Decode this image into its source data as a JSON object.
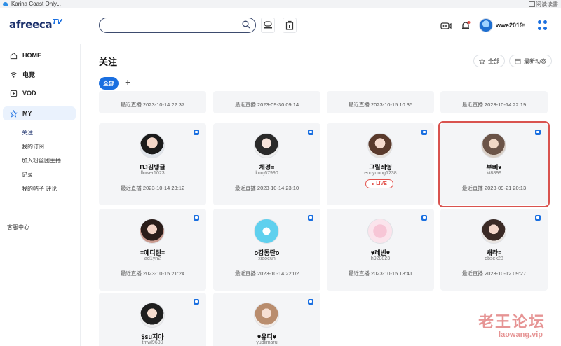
{
  "os_bar": {
    "app_title": "Karina Coast Only...",
    "read_mode": "阅读读書"
  },
  "header": {
    "logo": "afreeca",
    "logo_suffix": "TV",
    "search_placeholder": "",
    "username": "wwe2019",
    "icons": {
      "search": "search-icon",
      "afreecatv": "afreecatv-app-icon",
      "store": "store-icon",
      "broadcast": "broadcast-camera-icon",
      "notifications": "bell-icon",
      "apps": "apps-grid-icon"
    },
    "accent_color": "#1a6fe0"
  },
  "sidebar": {
    "nav": [
      {
        "label": "HOME",
        "icon": "home-icon",
        "active": false
      },
      {
        "label": "电竞",
        "icon": "esports-icon",
        "active": false
      },
      {
        "label": "VOD",
        "icon": "vod-icon",
        "active": false
      },
      {
        "label": "MY",
        "icon": "star-icon",
        "active": true
      }
    ],
    "sub": [
      "关注",
      "我的订阅",
      "加入粉丝团主播",
      "记录",
      "我的帖子 评论"
    ],
    "service_center": "客服中心"
  },
  "main": {
    "title": "关注",
    "sort_all": "全部",
    "sort_recent": "最新动态",
    "filter_all": "全部",
    "add_filter": "+"
  },
  "cards": {
    "top_row": [
      {
        "last_live": "最近直播 2023-10-14 22:37"
      },
      {
        "last_live": "最近直播 2023-09-30 09:14"
      },
      {
        "last_live": "最近直播 2023-10-15 10:35"
      },
      {
        "last_live": "最近直播 2023-10-14 22:19"
      }
    ],
    "row1": [
      {
        "name": "BJ김뱅글",
        "uid": "flower1023",
        "last_live": "最近直播 2023-10-14 23:12",
        "live": false
      },
      {
        "name": "체경≡",
        "uid": "knnj67990",
        "last_live": "最近直播 2023-10-14 23:10",
        "live": false
      },
      {
        "name": "그릴레영",
        "uid": "eunyoung1238",
        "last_live": "",
        "live": true,
        "live_label": "LIVE"
      },
      {
        "name": "부뻬♥",
        "uid": "kt8899",
        "last_live": "最近直播 2023-09-21 20:13",
        "live": false
      }
    ],
    "row2": [
      {
        "name": "≡에디린≡",
        "uid": "ad1yn2",
        "last_live": "最近直播 2023-10-15 21:24"
      },
      {
        "name": "o감동란o",
        "uid": "xiaoeun",
        "last_live": "最近直播 2023-10-14 22:02"
      },
      {
        "name": "♥레빈♥",
        "uid": "h920823",
        "last_live": "最近直播 2023-10-15 18:41"
      },
      {
        "name": "새라≡",
        "uid": "dbsek28",
        "last_live": "最近直播 2023-10-12 09:27"
      }
    ],
    "row3": [
      {
        "name": "$su지아",
        "uid": "tmwl9630"
      },
      {
        "name": "♥유디♥",
        "uid": "yudlimaru"
      }
    ]
  },
  "watermark": {
    "text": "老王论坛",
    "url": "laowang.vip"
  }
}
